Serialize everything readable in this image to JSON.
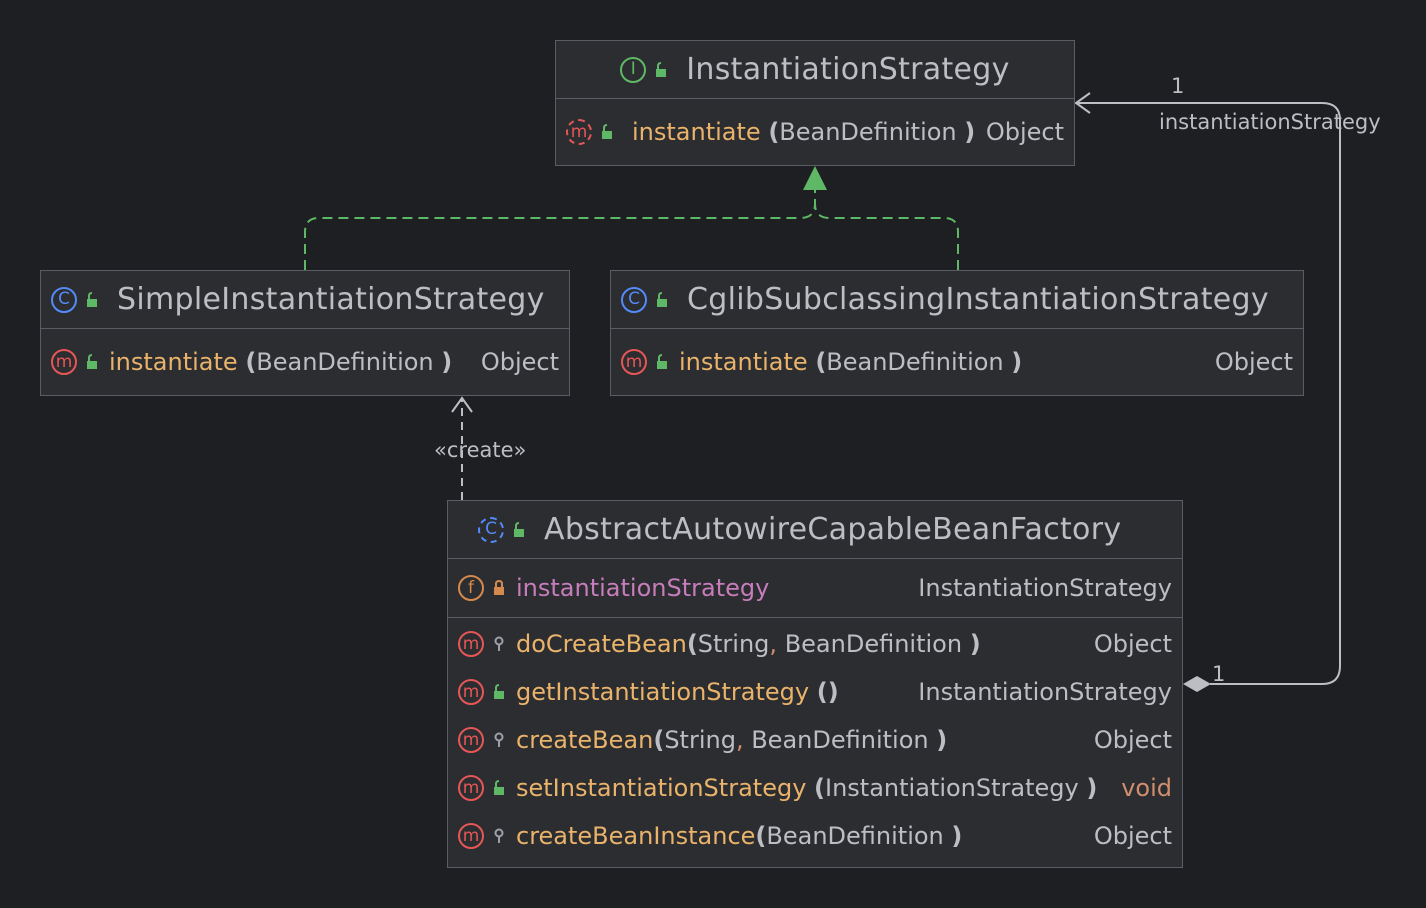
{
  "colors": {
    "background": "#1e1f22",
    "box": "#2b2d30",
    "border": "#5a5d63",
    "method": "#eab36b",
    "field": "#c77dbb",
    "realization": "#5fb865",
    "keyword": "#cf8e6d"
  },
  "instantiation_strategy": {
    "name": "InstantiationStrategy",
    "kind_icon": "interface-icon",
    "methods": [
      {
        "name": "instantiate",
        "params": "BeanDefinition",
        "returns": "Object",
        "icon": "abstract-method-icon",
        "visibility": "public"
      }
    ]
  },
  "simple_instantiation_strategy": {
    "name": "SimpleInstantiationStrategy",
    "kind_icon": "class-icon",
    "methods": [
      {
        "name": "instantiate",
        "params": "BeanDefinition",
        "returns": "Object",
        "icon": "method-icon",
        "visibility": "public"
      }
    ]
  },
  "cglib_subclassing_instantiation_strategy": {
    "name": "CglibSubclassingInstantiationStrategy",
    "kind_icon": "class-icon",
    "methods": [
      {
        "name": "instantiate",
        "params": "BeanDefinition",
        "returns": "Object",
        "icon": "method-icon",
        "visibility": "public"
      }
    ]
  },
  "abstract_autowire_capable_bean_factory": {
    "name": "AbstractAutowireCapableBeanFactory",
    "kind_icon": "abstract-class-icon",
    "fields": [
      {
        "name": "instantiationStrategy",
        "type": "InstantiationStrategy",
        "icon": "field-icon",
        "visibility": "private"
      }
    ],
    "methods": [
      {
        "name": "doCreateBean",
        "param1": "String",
        "sep": ",",
        "param2": "BeanDefinition",
        "returns": "Object",
        "visibility": "protected"
      },
      {
        "name": "getInstantiationStrategy",
        "params": "",
        "returns": "InstantiationStrategy",
        "visibility": "public"
      },
      {
        "name": "createBean",
        "param1": "String",
        "sep": ",",
        "param2": "BeanDefinition",
        "returns": "Object",
        "visibility": "protected"
      },
      {
        "name": "setInstantiationStrategy",
        "params": "InstantiationStrategy",
        "returns": "void",
        "visibility": "public"
      },
      {
        "name": "createBeanInstance",
        "params": "BeanDefinition",
        "returns": "Object",
        "visibility": "protected"
      }
    ]
  },
  "relations": {
    "create_stereotype": "«create»",
    "association_role": "instantiationStrategy",
    "association_target_multiplicity": "1",
    "association_source_multiplicity": "1"
  },
  "glyphs": {
    "class": "C",
    "interface": "I",
    "method": "m",
    "field": "f",
    "open": "(",
    "close": ")",
    "empty_params": "()"
  }
}
